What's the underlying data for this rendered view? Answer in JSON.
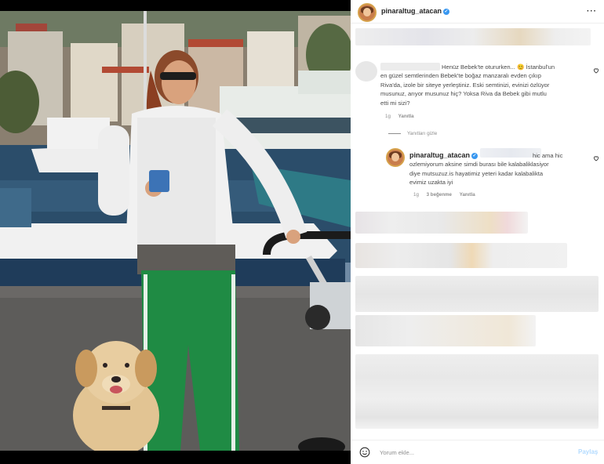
{
  "post": {
    "author": "pinaraltug_atacan",
    "verified": true,
    "more_icon": "more-horizontal-icon"
  },
  "comment": {
    "text_lines": [
      "Henüz Bebek'te otururken... 😊 İstanbul'un",
      "en güzel semtlerinden Bebek'te boğaz manzaralı evden çıkıp",
      "Riva'da, izole bir siteye yerleştiniz. Eski semtinizi, evinizi özlüyor",
      "musunuz, arıyor musunuz hiç? Yoksa Riva da Bebek gibi mutlu",
      "etti mi sizi?"
    ],
    "time": "1g",
    "reply_label": "Yanıtla"
  },
  "hide_replies_label": "Yanıtları gizle",
  "reply": {
    "author": "pinaraltug_atacan",
    "text_lines": [
      "hic ama hic",
      "ozlemiyorum aksine simdi burası bile kalabaliklasiyor",
      "diye mutsuzuz.is hayatimiz yeteri kadar kalabalikta",
      "evimiz uzakta iyi"
    ],
    "time": "1g",
    "likes": "3 beğenme",
    "reply_label": "Yanıtla"
  },
  "composer": {
    "placeholder": "Yorum ekle...",
    "post_label": "Paylaş",
    "emoji_icon": "smiley-icon"
  },
  "colors": {
    "accent": "#3897f0",
    "text": "#262626",
    "muted": "#8e8e8e",
    "post_disabled": "#b3dbff"
  }
}
